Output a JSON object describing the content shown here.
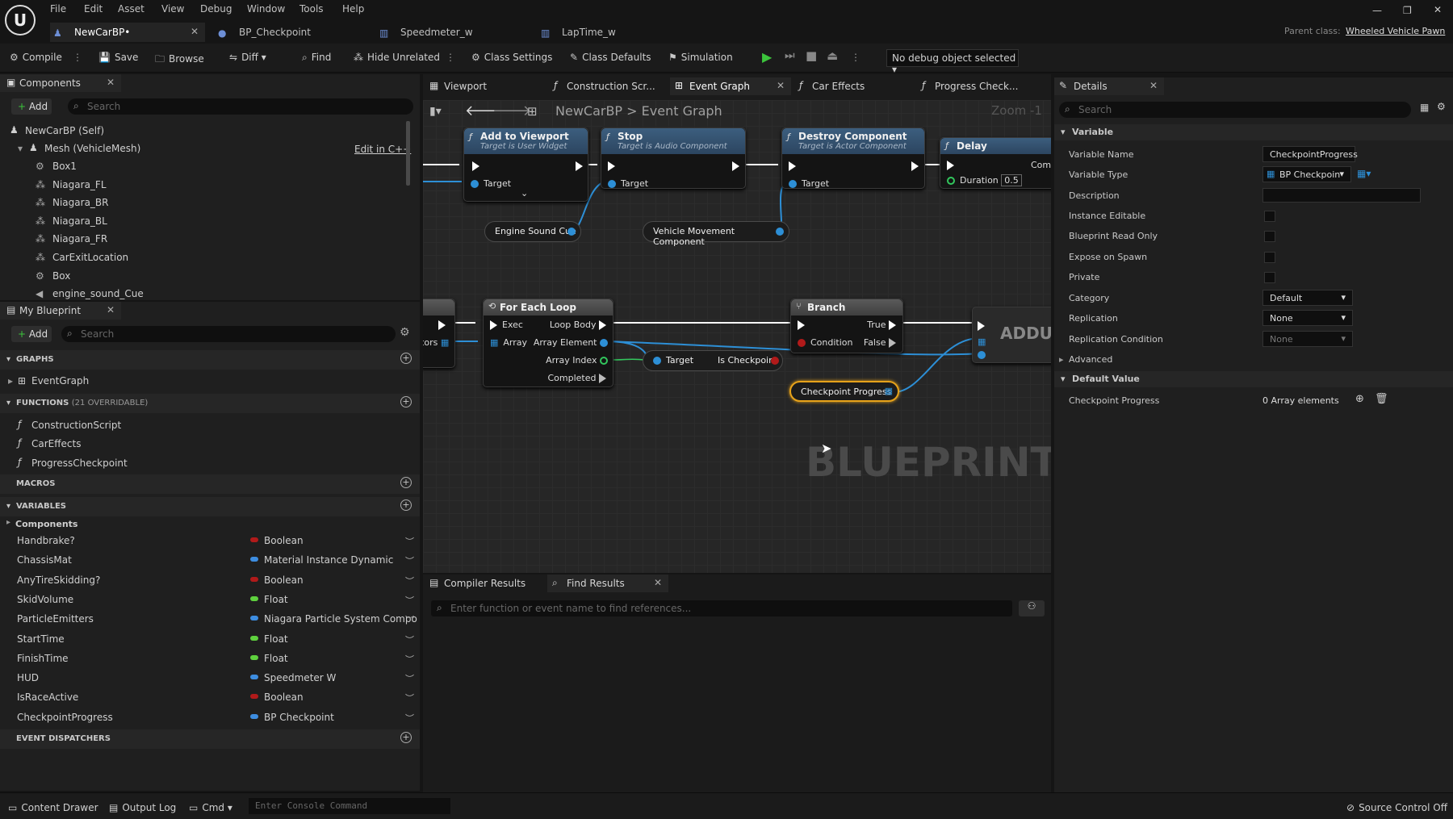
{
  "menu": [
    "File",
    "Edit",
    "Asset",
    "View",
    "Debug",
    "Window",
    "Tools",
    "Help"
  ],
  "tabs": [
    {
      "label": "NewCarBP•"
    },
    {
      "label": "BP_Checkpoint"
    },
    {
      "label": "Speedmeter_w"
    },
    {
      "label": "LapTime_w"
    }
  ],
  "parent_class": {
    "label": "Parent class:",
    "value": "Wheeled Vehicle Pawn"
  },
  "toolbar": {
    "compile": "Compile",
    "save": "Save",
    "browse": "Browse",
    "diff": "Diff",
    "find": "Find",
    "hide_unrelated": "Hide Unrelated",
    "class_settings": "Class Settings",
    "class_defaults": "Class Defaults",
    "simulation": "Simulation",
    "debug_object": "No debug object selected"
  },
  "components": {
    "tab": "Components",
    "add": "Add",
    "search_placeholder": "Search",
    "self": "NewCarBP (Self)",
    "mesh": "Mesh (VehicleMesh)",
    "edit_cpp": "Edit in C++",
    "items": [
      "Box1",
      "Niagara_FL",
      "Niagara_BR",
      "Niagara_BL",
      "Niagara_FR",
      "CarExitLocation",
      "Box",
      "engine_sound_Cue"
    ]
  },
  "my_blueprint": {
    "tab": "My Blueprint",
    "add": "Add",
    "search_placeholder": "Search",
    "graphs": "GRAPHS",
    "event_graph": "EventGraph",
    "functions": "FUNCTIONS",
    "functions_note": "(21 OVERRIDABLE)",
    "function_items": [
      "ConstructionScript",
      "CarEffects",
      "ProgressCheckpoint"
    ],
    "macros": "MACROS",
    "variables": "VARIABLES",
    "components_cat": "Components",
    "event_dispatchers": "EVENT DISPATCHERS",
    "vars": [
      {
        "name": "Handbrake?",
        "type": "Boolean",
        "color": "#b11a1a"
      },
      {
        "name": "ChassisMat",
        "type": "Material Instance Dynamic",
        "color": "#3d8de0"
      },
      {
        "name": "AnyTireSkidding?",
        "type": "Boolean",
        "color": "#b11a1a"
      },
      {
        "name": "SkidVolume",
        "type": "Float",
        "color": "#5fd13e"
      },
      {
        "name": "ParticleEmitters",
        "type": "Niagara Particle System Compo",
        "color": "#3d8de0"
      },
      {
        "name": "StartTime",
        "type": "Float",
        "color": "#5fd13e"
      },
      {
        "name": "FinishTime",
        "type": "Float",
        "color": "#5fd13e"
      },
      {
        "name": "HUD",
        "type": "Speedmeter W",
        "color": "#3d8de0"
      },
      {
        "name": "IsRaceActive",
        "type": "Boolean",
        "color": "#b11a1a"
      },
      {
        "name": "CheckpointProgress",
        "type": "BP Checkpoint",
        "color": "#3d8de0"
      }
    ]
  },
  "graph_tabs": [
    {
      "label": "Viewport"
    },
    {
      "label": "Construction Scr..."
    },
    {
      "label": "Event Graph"
    },
    {
      "label": "Car Effects"
    },
    {
      "label": "Progress Check..."
    }
  ],
  "graph": {
    "crumb_root": "NewCarBP",
    "crumb_sep": ">",
    "crumb_leaf": "Event Graph",
    "zoom": "Zoom -1",
    "watermark": "BLUEPRINT",
    "nodes": {
      "add_viewport": {
        "title": "Add to Viewport",
        "sub": "Target is User Widget",
        "target": "Target"
      },
      "stop": {
        "title": "Stop",
        "sub": "Target is Audio Component",
        "target": "Target"
      },
      "destroy": {
        "title": "Destroy Component",
        "sub": "Target is Actor Component",
        "target": "Target"
      },
      "delay": {
        "title": "Delay",
        "duration": "Duration",
        "duration_val": "0.5",
        "comp": "Comp"
      },
      "engine_cue": "Engine Sound Cue",
      "vmc": "Vehicle Movement Component",
      "for_each": {
        "title": "For Each Loop",
        "exec": "Exec",
        "array": "Array",
        "loop_body": "Loop Body",
        "array_element": "Array Element",
        "array_index": "Array Index",
        "completed": "Completed"
      },
      "branch": {
        "title": "Branch",
        "condition": "Condition",
        "true": "True",
        "false": "False"
      },
      "is_checkpoint": {
        "target": "Target",
        "label": "Is Checkpoint"
      },
      "checkpoint_progress": "Checkpoint Progress",
      "addunique": "ADDUN",
      "actors": "ctors"
    }
  },
  "details": {
    "tab": "Details",
    "search_placeholder": "Search",
    "variable_cat": "Variable",
    "rows": {
      "name_label": "Variable Name",
      "name_value": "CheckpointProgress",
      "type_label": "Variable Type",
      "type_value": "BP Checkpoin",
      "description": "Description",
      "instance_editable": "Instance Editable",
      "bp_read_only": "Blueprint Read Only",
      "expose_spawn": "Expose on Spawn",
      "private": "Private",
      "category": "Category",
      "category_value": "Default",
      "replication": "Replication",
      "replication_value": "None",
      "rep_condition": "Replication Condition",
      "rep_condition_value": "None",
      "advanced": "Advanced"
    },
    "default_cat": "Default Value",
    "checkpoint_label": "Checkpoint Progress",
    "array_value": "0 Array elements"
  },
  "bottom": {
    "compiler_results": "Compiler Results",
    "find_results": "Find Results",
    "find_placeholder": "Enter function or event name to find references..."
  },
  "status": {
    "content_drawer": "Content Drawer",
    "output_log": "Output Log",
    "cmd": "Cmd",
    "console_placeholder": "Enter Console Command",
    "source_control": "Source Control Off"
  }
}
